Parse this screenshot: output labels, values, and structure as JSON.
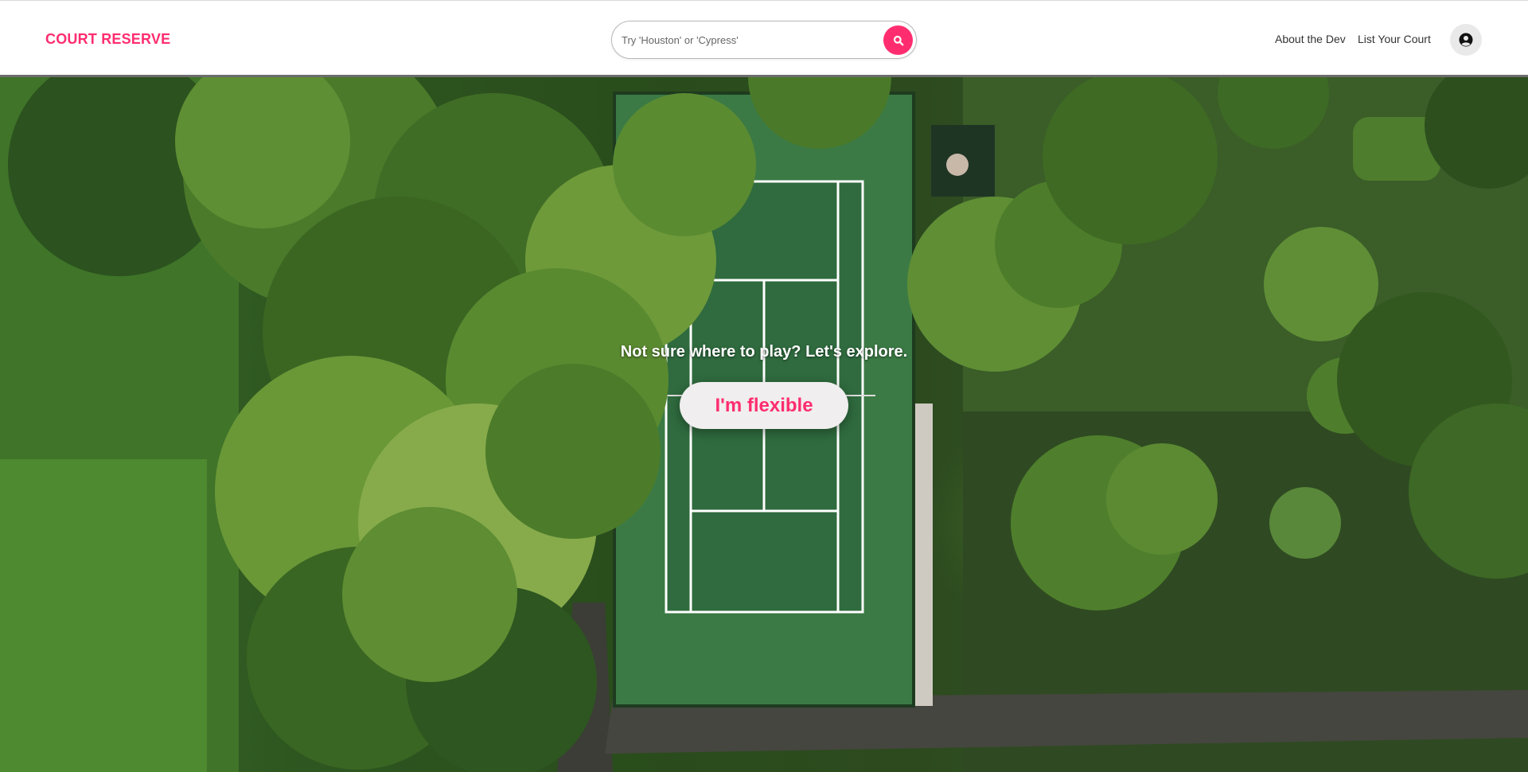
{
  "brand": {
    "name": "COURT RESERVE",
    "color": "#ff2d6f"
  },
  "search": {
    "placeholder": "Try 'Houston' or 'Cypress'",
    "value": "",
    "button_icon": "search-icon"
  },
  "nav": {
    "links": [
      {
        "label": "About the Dev"
      },
      {
        "label": "List Your Court"
      }
    ],
    "profile_icon": "user-circle-icon"
  },
  "hero": {
    "tagline": "Not sure where to play? Let's explore.",
    "cta_label": "I'm flexible",
    "background": "aerial-tennis-court-image"
  },
  "colors": {
    "accent": "#ff2d6f",
    "button_bg": "#f0eeee",
    "court_green": "#2f6b3e"
  }
}
